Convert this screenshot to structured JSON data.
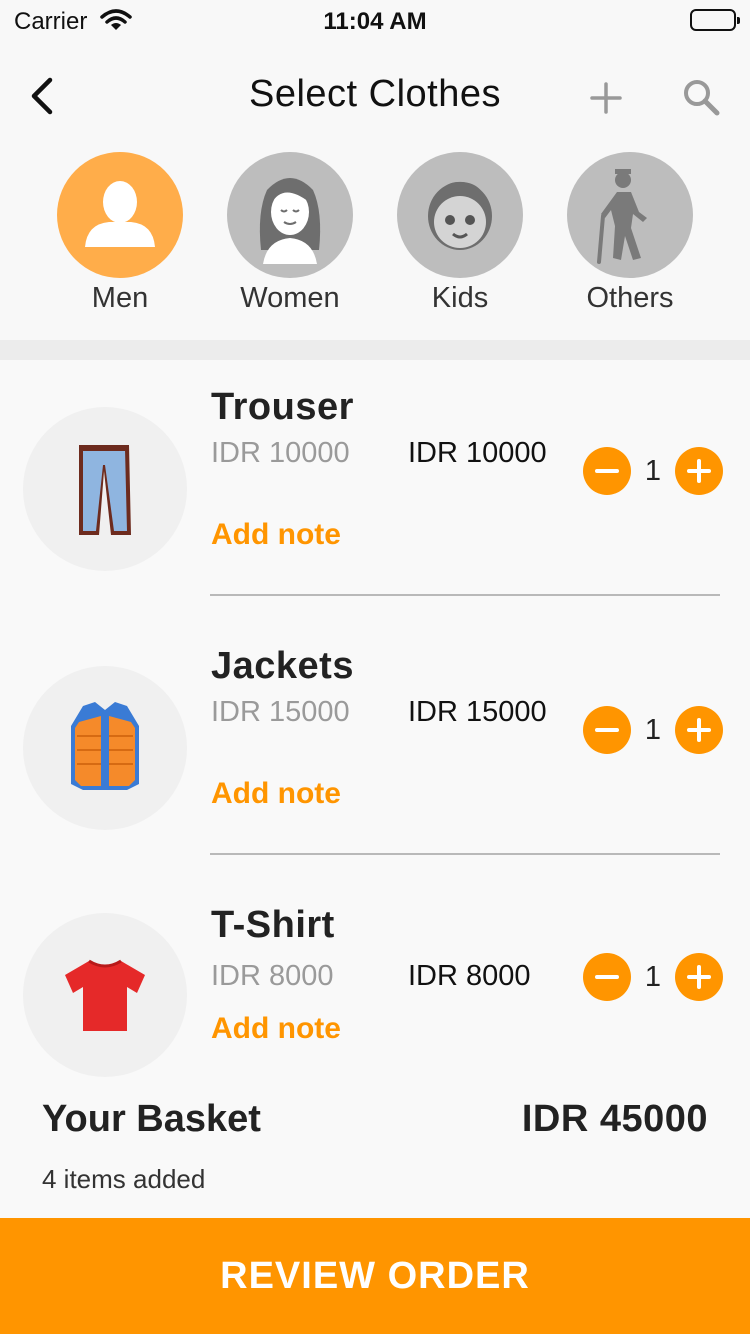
{
  "status_bar": {
    "carrier": "Carrier",
    "time": "11:04 AM"
  },
  "nav": {
    "title": "Select Clothes",
    "icons": [
      "chevron-left-icon",
      "plus-icon",
      "search-icon"
    ]
  },
  "categories": [
    {
      "label": "Men",
      "icon": "man-icon",
      "active": true
    },
    {
      "label": "Women",
      "icon": "woman-icon",
      "active": false
    },
    {
      "label": "Kids",
      "icon": "kid-icon",
      "active": false
    },
    {
      "label": "Others",
      "icon": "elderly-icon",
      "active": false
    }
  ],
  "products": [
    {
      "name": "Trouser",
      "price_old": "IDR 10000",
      "price_new": "IDR 10000",
      "note_label": "Add note",
      "qty": "1",
      "icon": "trouser-icon"
    },
    {
      "name": "Jackets",
      "price_old": "IDR 15000",
      "price_new": "IDR 15000",
      "note_label": "Add note",
      "qty": "1",
      "icon": "jacket-icon"
    },
    {
      "name": "T-Shirt",
      "price_old": "IDR 8000",
      "price_new": "IDR 8000",
      "note_label": "Add note",
      "qty": "1",
      "icon": "tshirt-icon"
    }
  ],
  "basket": {
    "title": "Your Basket",
    "total": "IDR 45000",
    "count_text": "4 items added"
  },
  "review_button": "REVIEW ORDER",
  "colors": {
    "accent": "#ff9500",
    "active_category": "#ffad4a",
    "inactive_category": "#bdbdbd"
  }
}
